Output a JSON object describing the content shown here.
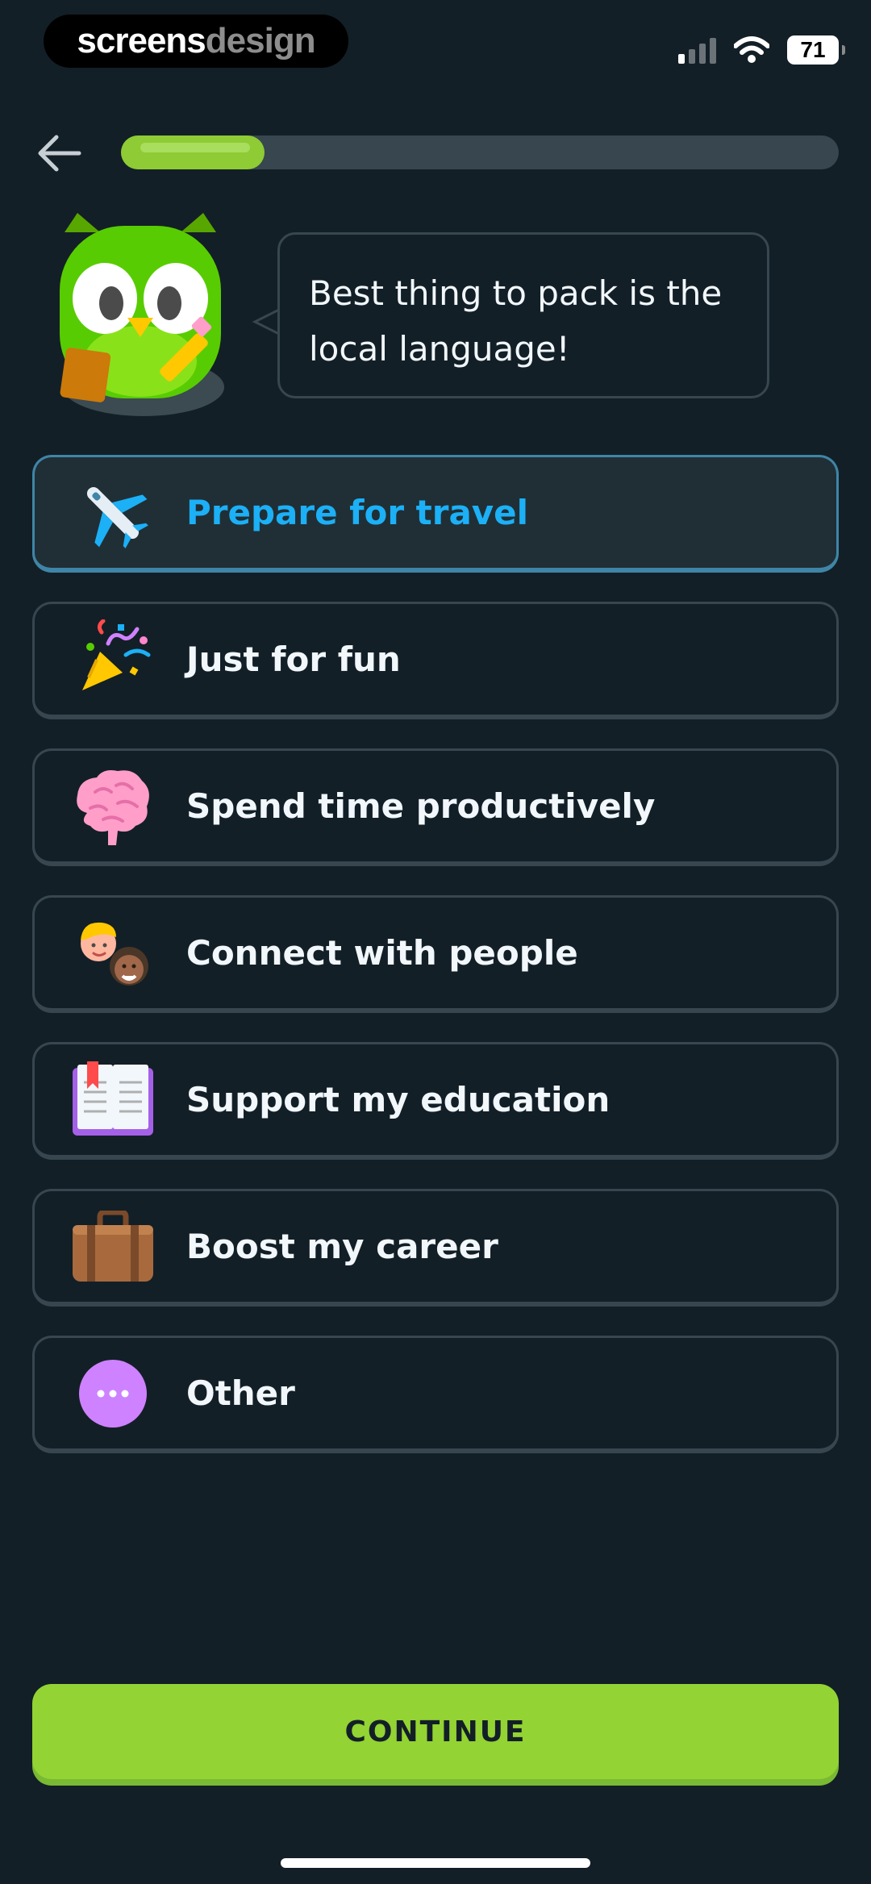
{
  "watermark": {
    "part1": "screens",
    "part2": "design"
  },
  "status_bar": {
    "battery": "71"
  },
  "header": {
    "progress": 0.2
  },
  "mascot": {
    "speech": "Best thing to pack is the local language!"
  },
  "options": [
    {
      "label": "Prepare for travel",
      "icon": "airplane-icon",
      "selected": true
    },
    {
      "label": "Just for fun",
      "icon": "party-popper-icon",
      "selected": false
    },
    {
      "label": "Spend time productively",
      "icon": "brain-icon",
      "selected": false
    },
    {
      "label": "Connect with people",
      "icon": "people-icon",
      "selected": false
    },
    {
      "label": "Support my education",
      "icon": "book-icon",
      "selected": false
    },
    {
      "label": "Boost my career",
      "icon": "briefcase-icon",
      "selected": false
    },
    {
      "label": "Other",
      "icon": "more-dots-icon",
      "selected": false
    }
  ],
  "continue_label": "CONTINUE",
  "colors": {
    "background": "#131f27",
    "accent_green": "#93d333",
    "selected_blue": "#1cb0f6",
    "border": "#37464f"
  }
}
